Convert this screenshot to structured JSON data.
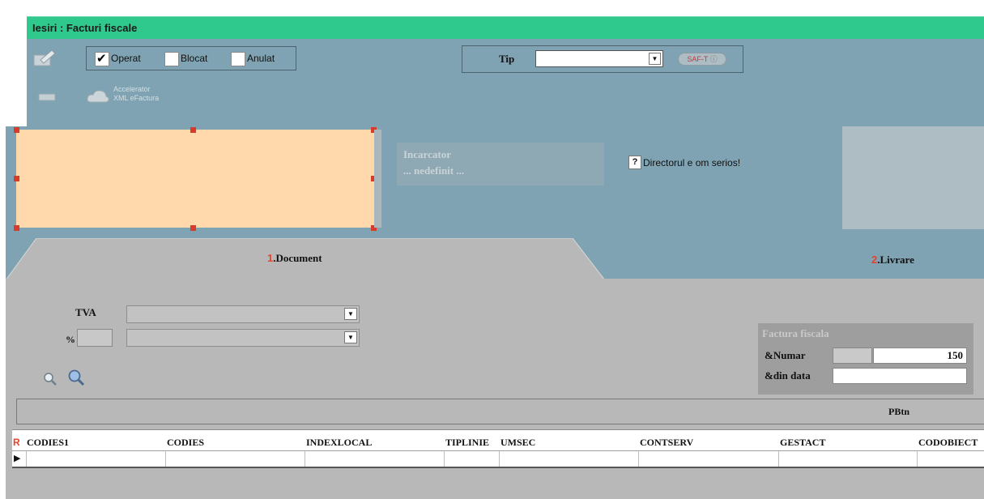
{
  "window": {
    "title": "Iesiri : Facturi fiscale"
  },
  "toolbar": {
    "status_checks": [
      {
        "label": "Operat",
        "checked": true
      },
      {
        "label": "Blocat",
        "checked": false
      },
      {
        "label": "Anulat",
        "checked": false
      }
    ],
    "tip_label": "Tip",
    "tip_value": "",
    "saft_badge": "SAF-T",
    "accelerator_line1": "Accelerator",
    "accelerator_line2": "XML eFactura"
  },
  "loader": {
    "title": "Incarcator",
    "value": "... nedefinit ..."
  },
  "help": {
    "icon": "?",
    "text": "Directorul e om serios!"
  },
  "tabs": [
    {
      "num": "1",
      "label": ".Document",
      "active": true
    },
    {
      "num": "2",
      "label": ".Livrare",
      "active": false
    }
  ],
  "document": {
    "tva_label": "TVA",
    "pct_label": "%",
    "tva_value": "",
    "pct_value": "",
    "invoice_group_title": "Factura fiscala",
    "numar_label": "&Numar",
    "numar_series": "",
    "numar_value": "150",
    "data_label": "&din data",
    "data_value": ""
  },
  "pbtn_label": "PBtn",
  "grid": {
    "row_marker": "R",
    "columns": [
      "CODIES1",
      "CODIES",
      "INDEXLOCAL",
      "TIPLINIE",
      "UMSEC",
      "CONTSERV",
      "GESTACT",
      "CODOBIECT"
    ]
  },
  "colors": {
    "title_bar": "#2fc98e",
    "panel": "#7fa3b2",
    "body": "#b8b8b8",
    "image_box": "#ffd9ab",
    "handle": "#d73b2a",
    "tab_number": "#e8412c"
  }
}
